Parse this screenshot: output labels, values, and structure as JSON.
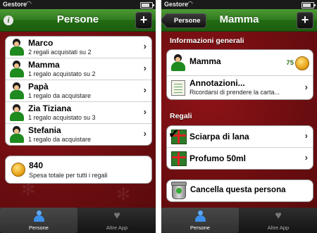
{
  "left": {
    "status": {
      "carrier": "Gestore",
      "wifi_icon": "wifi-icon"
    },
    "nav": {
      "title": "Persone",
      "add_label": "+"
    },
    "people": [
      {
        "name": "Marco",
        "sub": "2 regali acquistati su 2"
      },
      {
        "name": "Mamma",
        "sub": "1 regalo acquistato su 2"
      },
      {
        "name": "Papà",
        "sub": "1 regalo da acquistare"
      },
      {
        "name": "Zia Tiziana",
        "sub": "1 regalo acquistato su 3"
      },
      {
        "name": "Stefania",
        "sub": "1 regalo da acquistare"
      }
    ],
    "total": {
      "amount": "840",
      "label": "Spesa totale per tutti i regali"
    },
    "tabs": [
      {
        "label": "Persone"
      },
      {
        "label": "Altre App"
      }
    ]
  },
  "right": {
    "status": {
      "carrier": "Gestore"
    },
    "nav": {
      "back_label": "Persone",
      "title": "Mamma",
      "add_label": "+"
    },
    "general_header": "Informazioni generali",
    "person": {
      "name": "Mamma",
      "budget": "75"
    },
    "notes": {
      "title": "Annotazioni...",
      "text": "Ricordarsi di prendere la carta..."
    },
    "gifts_header": "Regali",
    "gifts": [
      {
        "name": "Sciarpa di lana",
        "purchased": true
      },
      {
        "name": "Profumo 50ml",
        "purchased": false
      }
    ],
    "delete_label": "Cancella questa persona",
    "tabs": [
      {
        "label": "Persone"
      },
      {
        "label": "Altre App"
      }
    ]
  },
  "colors": {
    "nav_green": "#2f7a1e",
    "background_red": "#6b0d10",
    "coin_gold": "#e7a31a"
  }
}
